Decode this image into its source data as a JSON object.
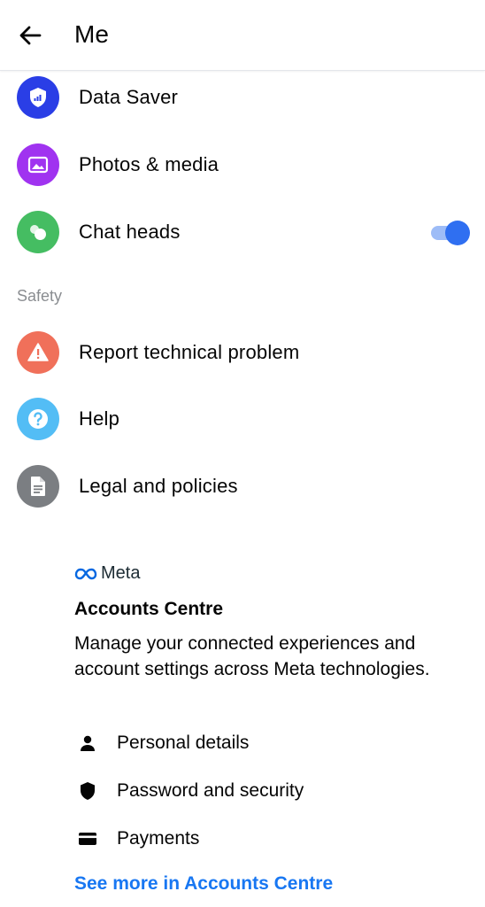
{
  "header": {
    "title": "Me"
  },
  "settings_items": [
    {
      "label": "Data Saver",
      "icon": "shield-data-icon",
      "color": "#2a3ee6"
    },
    {
      "label": "Photos & media",
      "icon": "photo-icon",
      "color": "#a033f0"
    },
    {
      "label": "Chat heads",
      "icon": "chat-heads-icon",
      "color": "#45bd62",
      "toggle": true
    }
  ],
  "safety": {
    "title": "Safety",
    "items": [
      {
        "label": "Report technical problem",
        "icon": "warning-icon",
        "color": "#f0705a"
      },
      {
        "label": "Help",
        "icon": "question-icon",
        "color": "#53bdf5"
      },
      {
        "label": "Legal and policies",
        "icon": "document-icon",
        "color": "#7b7e82"
      }
    ]
  },
  "accounts_centre": {
    "brand": "Meta",
    "title": "Accounts Centre",
    "description": "Manage your connected experiences and account settings across Meta technologies.",
    "items": [
      {
        "label": "Personal details",
        "icon": "person-icon"
      },
      {
        "label": "Password and security",
        "icon": "shield-icon"
      },
      {
        "label": "Payments",
        "icon": "card-icon"
      }
    ],
    "see_more": "See more in Accounts Centre"
  },
  "colors": {
    "link": "#1877f2",
    "toggle_on": "#2f6ff1"
  }
}
